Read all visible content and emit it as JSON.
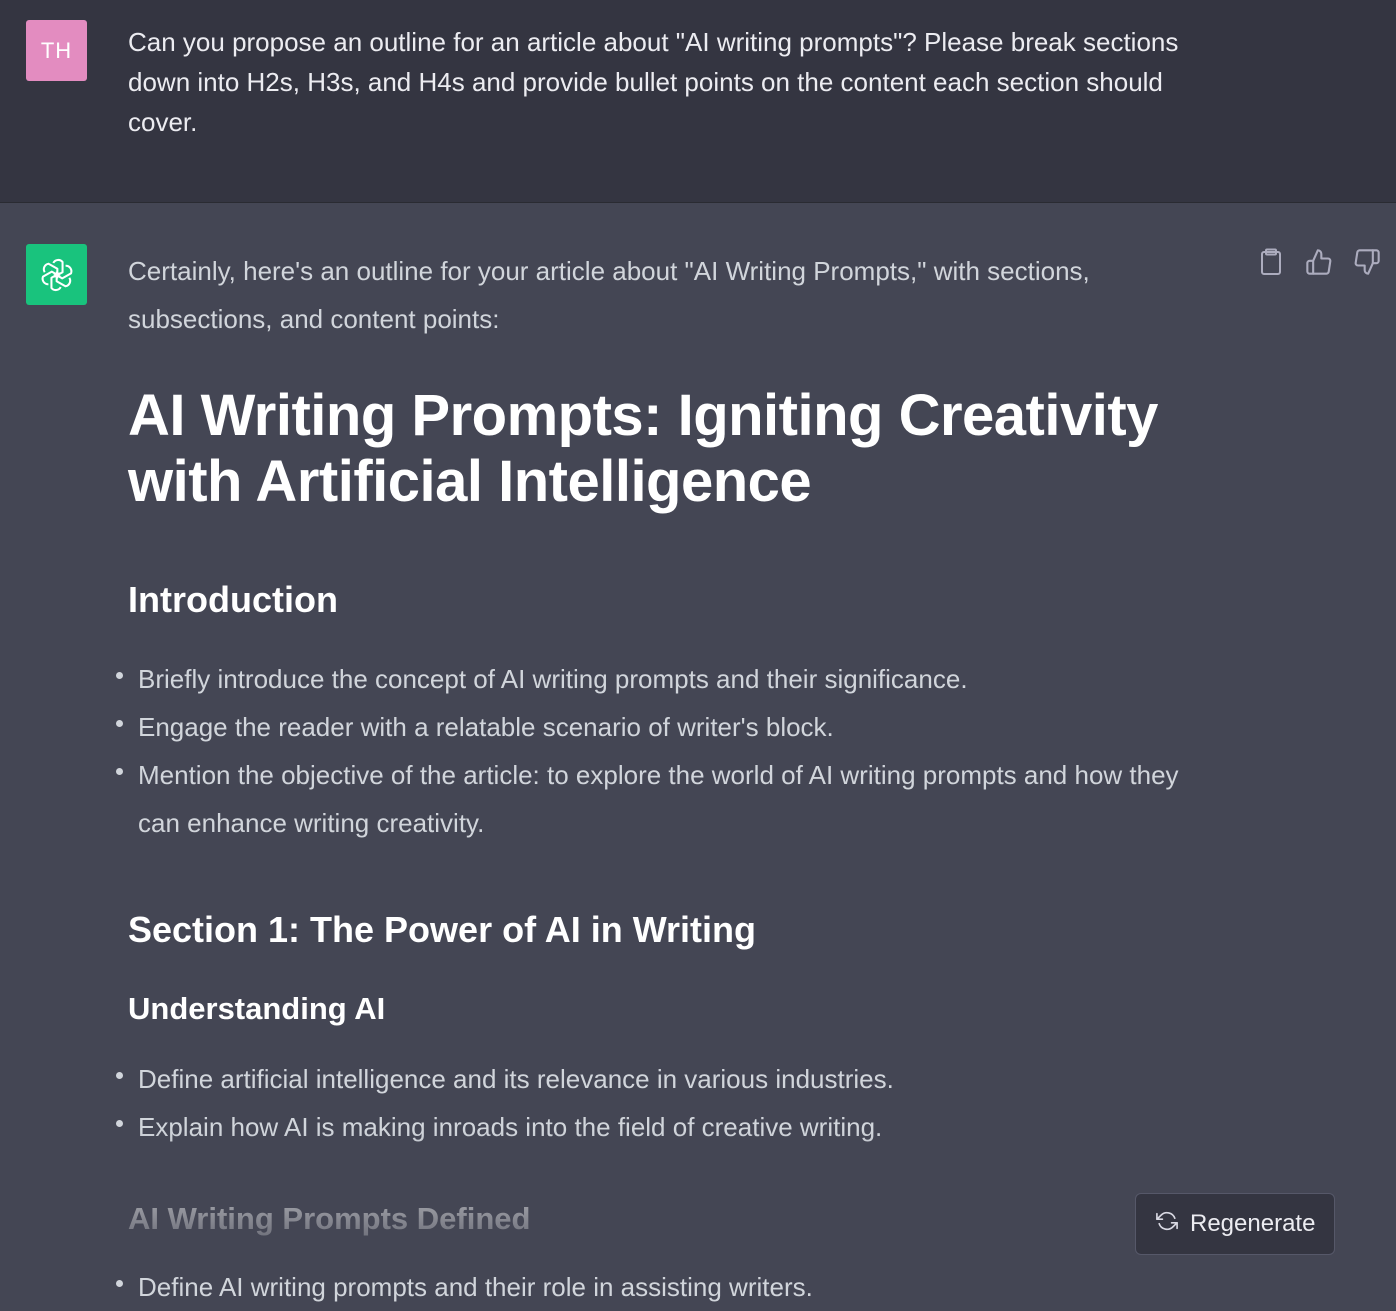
{
  "colors": {
    "user_bg": "#343541",
    "assistant_bg": "#444654",
    "user_avatar": "#e38cc0",
    "assistant_avatar": "#19c37d"
  },
  "user_message": {
    "avatar_initials": "TH",
    "text": "Can you propose an outline for an article about \"AI writing prompts\"? Please break sections down into H2s, H3s, and H4s and provide bullet points on the content each section should cover."
  },
  "assistant_message": {
    "avatar_icon": "openai-logo-icon",
    "actions": [
      "copy-icon",
      "thumbs-up-icon",
      "thumbs-down-icon"
    ],
    "intro": "Certainly, here's an outline for your article about \"AI Writing Prompts,\" with sections, subsections, and content points:",
    "title": "AI Writing Prompts: Igniting Creativity with Artificial Intelligence",
    "introduction": {
      "heading": "Introduction",
      "bullets": [
        "Briefly introduce the concept of AI writing prompts and their significance.",
        "Engage the reader with a relatable scenario of writer's block.",
        "Mention the objective of the article: to explore the world of AI writing prompts and how they can enhance writing creativity."
      ]
    },
    "section1": {
      "heading": "Section 1: The Power of AI in Writing",
      "understanding": {
        "heading": "Understanding AI",
        "bullets": [
          "Define artificial intelligence and its relevance in various industries.",
          "Explain how AI is making inroads into the field of creative writing."
        ]
      },
      "defined": {
        "heading": "AI Writing Prompts Defined",
        "bullets": [
          "Define AI writing prompts and their role in assisting writers."
        ]
      }
    }
  },
  "regenerate": {
    "label": "Regenerate",
    "icon": "refresh-icon"
  }
}
